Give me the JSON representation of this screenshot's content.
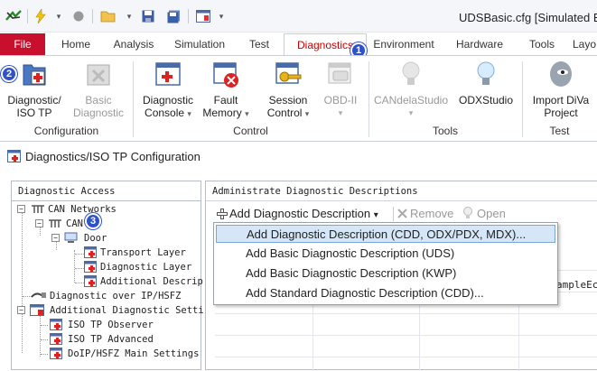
{
  "window": {
    "title": "UDSBasic.cfg [Simulated Bus"
  },
  "tabs": {
    "file": "File",
    "home": "Home",
    "analysis": "Analysis",
    "simulation": "Simulation",
    "test": "Test",
    "diagnostics": "Diagnostics",
    "environment": "Environment",
    "hardware": "Hardware",
    "tools": "Tools",
    "layout": "Layo"
  },
  "ribbon": {
    "diag_iso": "Diagnostic/\nISO TP",
    "basic_diag": "Basic\nDiagnostic",
    "diag_console": "Diagnostic\nConsole",
    "fault_memory": "Fault\nMemory",
    "session_control": "Session\nControl",
    "obd": "OBD-II",
    "candela": "CANdelaStudio",
    "odx": "ODXStudio",
    "diva": "Import DiVa\nProject",
    "groups": {
      "configuration": "Configuration",
      "control": "Control",
      "tools": "Tools",
      "test": "Test"
    },
    "dropdown_glyph": "▾"
  },
  "badges": {
    "one": "1",
    "two": "2",
    "three": "3"
  },
  "config_window": {
    "title": "Diagnostics/ISO TP Configuration"
  },
  "left_pane": {
    "header": "Diagnostic Access",
    "tree": {
      "can_networks": "CAN Networks",
      "can": "CAN",
      "door": "Door",
      "transport_layer": "Transport Layer",
      "diagnostic_layer": "Diagnostic Layer",
      "additional_descr": "Additional Descrip",
      "diag_over_ip": "Diagnostic over IP/HSFZ",
      "additional_settings": "Additional Diagnostic Setti",
      "iso_tp_observer": "ISO TP Observer",
      "iso_tp_advanced": "ISO TP Advanced",
      "doip_main": "DoIP/HSFZ Main Settings"
    }
  },
  "right_pane": {
    "header": "Administrate Diagnostic Descriptions",
    "toolbar": {
      "add": "Add Diagnostic Description",
      "remove": "Remove",
      "open": "Open"
    },
    "bg_cell": "ampleEcu"
  },
  "menu": {
    "items": [
      "Add Diagnostic Description (CDD, ODX/PDX, MDX)...",
      "Add Basic Diagnostic Description (UDS)",
      "Add Basic Diagnostic Description (KWP)",
      "Add Standard Diagnostic Description (CDD)..."
    ]
  },
  "colors": {
    "accent": "#c8102e",
    "badge": "#2f52c8",
    "highlight": "#d5e6f7"
  }
}
